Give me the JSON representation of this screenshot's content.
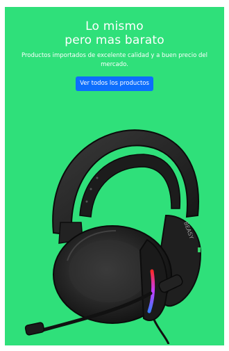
{
  "hero": {
    "title_line1": "Lo mismo",
    "title_line2": "pero mas barato",
    "subtitle": "Productos importados de excelente calidad y a buen precio del mercado.",
    "cta_label": "Ver todos los productos",
    "background_color": "#2fe07a",
    "button_color": "#0d6efd"
  },
  "product_image": {
    "alt": "auriculares gamer",
    "brand_text": "BEASY"
  }
}
